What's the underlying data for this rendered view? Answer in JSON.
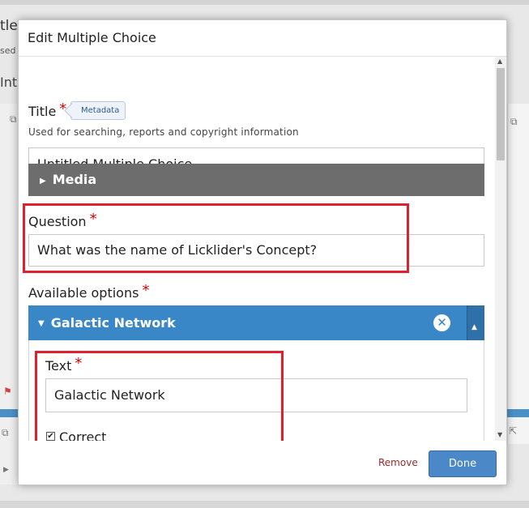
{
  "background": {
    "title_fragment": "tle",
    "sub_fragment": "sed",
    "tab_fragment": "Inte"
  },
  "dialog": {
    "title": "Edit Multiple Choice",
    "title_field": {
      "label": "Title",
      "required_mark": "*",
      "tag": "Metadata",
      "description": "Used for searching, reports and copyright information",
      "value": "Untitled Multiple Choice"
    },
    "media": {
      "label": "Media",
      "icon": "caret-right-icon"
    },
    "question": {
      "label": "Question",
      "required_mark": "*",
      "value": "What was the name of Licklider's Concept?"
    },
    "options": {
      "label": "Available options",
      "required_mark": "*",
      "items": [
        {
          "header": "Galactic Network",
          "text_label": "Text",
          "required_mark": "*",
          "text_value": "Galactic Network",
          "correct_label": "Correct",
          "correct_checked": true
        }
      ]
    },
    "footer": {
      "remove_label": "Remove",
      "done_label": "Done"
    }
  },
  "colors": {
    "option_header": "#3a87c8",
    "media_header": "#6d6d6d",
    "highlight_box": "#e0202e",
    "required": "#d40000"
  }
}
